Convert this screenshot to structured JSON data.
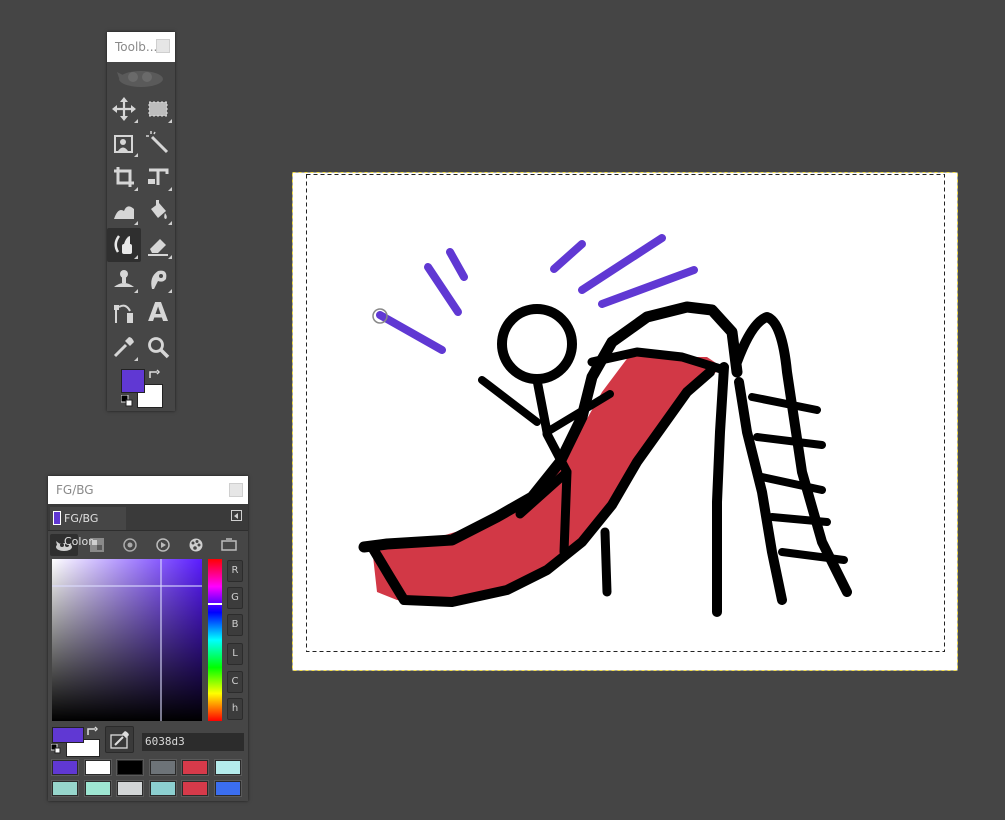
{
  "toolbox": {
    "title": "Toolb...",
    "tools": [
      {
        "name": "move-tool",
        "icon": "move-icon"
      },
      {
        "name": "rect-select-tool",
        "icon": "rect-select-icon"
      },
      {
        "name": "foreground-select-tool",
        "icon": "foreground-select-icon"
      },
      {
        "name": "fuzzy-select-tool",
        "icon": "magic-wand-icon"
      },
      {
        "name": "crop-tool",
        "icon": "crop-icon"
      },
      {
        "name": "unified-transform-tool",
        "icon": "transform-icon"
      },
      {
        "name": "warp-transform-tool",
        "icon": "warp-icon"
      },
      {
        "name": "bucket-fill-tool",
        "icon": "bucket-fill-icon"
      },
      {
        "name": "paintbrush-tool",
        "icon": "paintbrush-icon",
        "active": true
      },
      {
        "name": "eraser-tool",
        "icon": "eraser-icon"
      },
      {
        "name": "clone-tool",
        "icon": "clone-stamp-icon"
      },
      {
        "name": "smudge-tool",
        "icon": "smudge-icon"
      },
      {
        "name": "paths-tool",
        "icon": "paths-icon"
      },
      {
        "name": "text-tool",
        "icon": "text-icon",
        "glyph": "A"
      },
      {
        "name": "color-picker-tool",
        "icon": "eyedropper-icon"
      },
      {
        "name": "zoom-tool",
        "icon": "magnifier-icon"
      }
    ],
    "fg_color": "#6038d3",
    "bg_color": "#ffffff"
  },
  "fgbg": {
    "title": "FG/BG",
    "tab_label": "FG/BG Color",
    "channels": [
      "R",
      "G",
      "B",
      "L",
      "C",
      "h"
    ],
    "hex_value": "6038d3",
    "fg_color": "#6038d3",
    "bg_color": "#ffffff",
    "selectors": [
      "gimp-selector-icon",
      "cmyk-selector-icon",
      "water-selector-icon",
      "wheel-selector-icon",
      "palette-selector-icon",
      "scales-selector-icon"
    ],
    "swatches": [
      "#6038d3",
      "#ffffff",
      "#000000",
      "#6d7378",
      "#d63a4a",
      "#b5ecec",
      "#97d6cc",
      "#9ee6d2",
      "#d3d6d7",
      "#8ccfd0",
      "#d63a4a",
      "#3b6ef0"
    ]
  },
  "canvas": {
    "background": "#ffffff",
    "ink": "#000000",
    "slide_color": "#d23846",
    "brush_color": "#6038d3"
  }
}
